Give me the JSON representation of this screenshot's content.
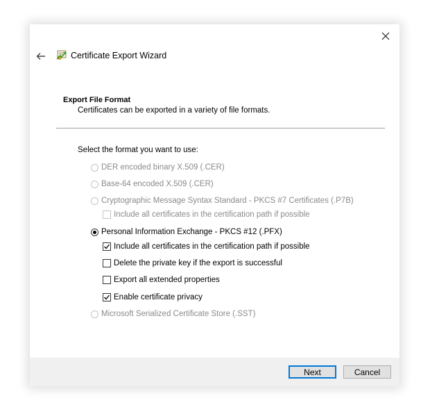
{
  "window": {
    "title": "Certificate Export Wizard"
  },
  "section": {
    "title": "Export File Format",
    "description": "Certificates can be exported in a variety of file formats."
  },
  "prompt": "Select the format you want to use:",
  "options": [
    {
      "label": "DER encoded binary X.509 (.CER)",
      "kind": "radio",
      "checked": false,
      "enabled": false
    },
    {
      "label": "Base-64 encoded X.509 (.CER)",
      "kind": "radio",
      "checked": false,
      "enabled": false
    },
    {
      "label": "Cryptographic Message Syntax Standard - PKCS #7 Certificates (.P7B)",
      "kind": "radio",
      "checked": false,
      "enabled": false
    },
    {
      "label": "Include all certificates in the certification path if possible",
      "kind": "checkbox",
      "checked": false,
      "enabled": false
    },
    {
      "label": "Personal Information Exchange - PKCS #12 (.PFX)",
      "kind": "radio",
      "checked": true,
      "enabled": true
    },
    {
      "label": "Include all certificates in the certification path if possible",
      "kind": "checkbox",
      "checked": true,
      "enabled": true
    },
    {
      "label": "Delete the private key if the export is successful",
      "kind": "checkbox",
      "checked": false,
      "enabled": true
    },
    {
      "label": "Export all extended properties",
      "kind": "checkbox",
      "checked": false,
      "enabled": true
    },
    {
      "label": "Enable certificate privacy",
      "kind": "checkbox",
      "checked": true,
      "enabled": true
    },
    {
      "label": "Microsoft Serialized Certificate Store (.SST)",
      "kind": "radio",
      "checked": false,
      "enabled": false
    }
  ],
  "buttons": {
    "next": "Next",
    "cancel": "Cancel"
  },
  "colors": {
    "accent": "#0078d7",
    "footer": "#f0f0f0",
    "disabled_text": "#8a8a8a"
  },
  "icons": {
    "close": "close-icon",
    "back": "back-arrow-icon",
    "wizard": "certificate-icon"
  }
}
